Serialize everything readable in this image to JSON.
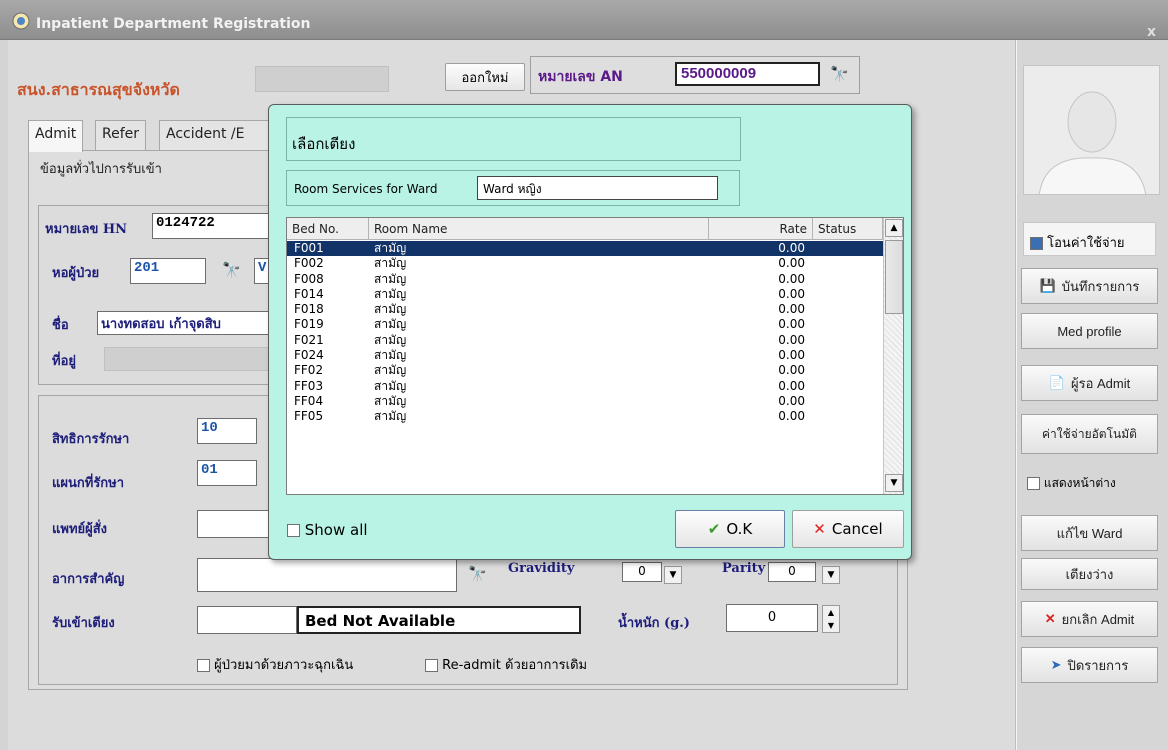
{
  "window": {
    "title": "Inpatient Department Registration",
    "close": "x"
  },
  "header": {
    "hospital": "สนง.สาธารณสุขจังหวัด",
    "new_button": "ออกใหม่",
    "an_label": "หมายเลข AN",
    "an_value": "550000009"
  },
  "tabs": [
    "Admit",
    "Refer",
    "Accident /E"
  ],
  "form": {
    "subheader": "ข้อมูลทั่วไปการรับเข้า",
    "hn_label": "หมายเลข HN",
    "hn_value": "0124722",
    "ward_label": "หอผู้ป่วย",
    "ward_value": "201",
    "ward_name_prefix": "V",
    "name_label": "ชื่อ",
    "name_value": "นางทดสอบ  เก้าจุดสิบ",
    "address_label": "ที่อยู่",
    "rights_label": "สิทธิการรักษา",
    "rights_value": "10",
    "dept_label": "แผนกที่รักษา",
    "dept_value": "01",
    "doctor_label": "แพทย์ผู้สั่ง",
    "symptom_label": "อาการสำคัญ",
    "gravidity_label": "Gravidity",
    "gravidity_value": "0",
    "parity_label": "Parity",
    "parity_value": "0",
    "bed_label": "รับเข้าเตียง",
    "bed_status": "Bed Not Available",
    "weight_label": "น้ำหนัก (g.)",
    "weight_value": "0",
    "emergency_check": "ผู้ป่วยมาด้วยภาวะฉุกเฉิน",
    "readmit_check": "Re-admit ด้วยอาการเดิม"
  },
  "dialog": {
    "title": "เลือกเตียง",
    "ward_label": "Room Services for Ward",
    "ward_value": "Ward หญิง",
    "columns": [
      "Bed No.",
      "Room Name",
      "Rate",
      "Status"
    ],
    "rows": [
      {
        "bed": "F001",
        "room": "สามัญ",
        "rate": "0.00",
        "status": ""
      },
      {
        "bed": "F002",
        "room": "สามัญ",
        "rate": "0.00",
        "status": ""
      },
      {
        "bed": "F008",
        "room": "สามัญ",
        "rate": "0.00",
        "status": ""
      },
      {
        "bed": "F014",
        "room": "สามัญ",
        "rate": "0.00",
        "status": ""
      },
      {
        "bed": "F018",
        "room": "สามัญ",
        "rate": "0.00",
        "status": ""
      },
      {
        "bed": "F019",
        "room": "สามัญ",
        "rate": "0.00",
        "status": ""
      },
      {
        "bed": "F021",
        "room": "สามัญ",
        "rate": "0.00",
        "status": ""
      },
      {
        "bed": "F024",
        "room": "สามัญ",
        "rate": "0.00",
        "status": ""
      },
      {
        "bed": "FF02",
        "room": "สามัญ",
        "rate": "0.00",
        "status": ""
      },
      {
        "bed": "FF03",
        "room": "สามัญ",
        "rate": "0.00",
        "status": ""
      },
      {
        "bed": "FF04",
        "room": "สามัญ",
        "rate": "0.00",
        "status": ""
      },
      {
        "bed": "FF05",
        "room": "สามัญ",
        "rate": "0.00",
        "status": ""
      }
    ],
    "show_all": "Show all",
    "ok": "O.K",
    "cancel": "Cancel"
  },
  "sidebar": {
    "transfer_cost": "โอนค่าใช้จ่าย",
    "save": "บันทึกรายการ",
    "med_profile": "Med profile",
    "waiting_admit": "ผู้รอ Admit",
    "auto_cost": "ค่าใช้จ่ายอัตโนมัติ",
    "show_window": "แสดงหน้าต่าง",
    "edit_ward": "แก้ไข Ward",
    "free_bed": "เตียงว่าง",
    "cancel_admit": "ยกเลิก Admit",
    "close": "ปิดรายการ"
  },
  "colors": {
    "accent_dialog": "#b9f3e6",
    "selected_row": "#123368",
    "label_blue": "#1d1d7a"
  }
}
